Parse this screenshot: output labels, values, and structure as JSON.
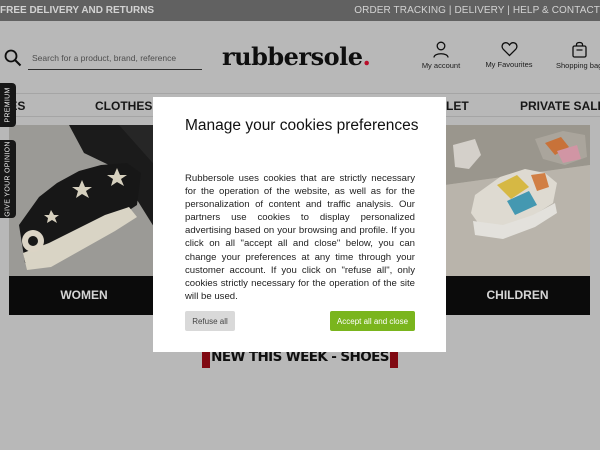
{
  "topbar": {
    "left_text": "FREE DELIVERY AND RETURNS",
    "right_text": "ORDER TRACKING | DELIVERY | HELP & CONTACT"
  },
  "header": {
    "search_placeholder": "Search for a product, brand, reference",
    "logo_text": "rubbersole",
    "logo_dot": ".",
    "account_label": "My account",
    "favourites_label": "My Favourites",
    "bag_label": "Shopping bag"
  },
  "nav": {
    "items": [
      "OES",
      "CLOTHES",
      "LET",
      "PRIVATE SALES"
    ]
  },
  "side_tabs": {
    "premium": "PREMIUM",
    "opinion": "GIVE YOUR OPINION"
  },
  "categories": {
    "women": "WOMEN",
    "children": "CHILDREN"
  },
  "section": {
    "new_this_week": "NEW THIS WEEK - SHOES"
  },
  "cookie_modal": {
    "title": "Manage your cookies preferences",
    "body": "Rubbersole uses cookies that are strictly necessary for the operation of the website, as well as for the personalization of content and traffic analysis. Our partners use cookies to display personalized advertising based on your browsing and profile. If you click on all \"accept all and close\" below, you can change your preferences at any time through your customer account. If you click on \"refuse all\", only cookies strictly necessary for the operation of the site will be used.",
    "refuse_label": "Refuse all",
    "accept_label": "Accept all and close"
  },
  "colors": {
    "accept_button": "#7ab51d",
    "logo_dot": "#c8102e",
    "section_accent": "#8b0a14",
    "topbar": "#6a6a6a"
  }
}
